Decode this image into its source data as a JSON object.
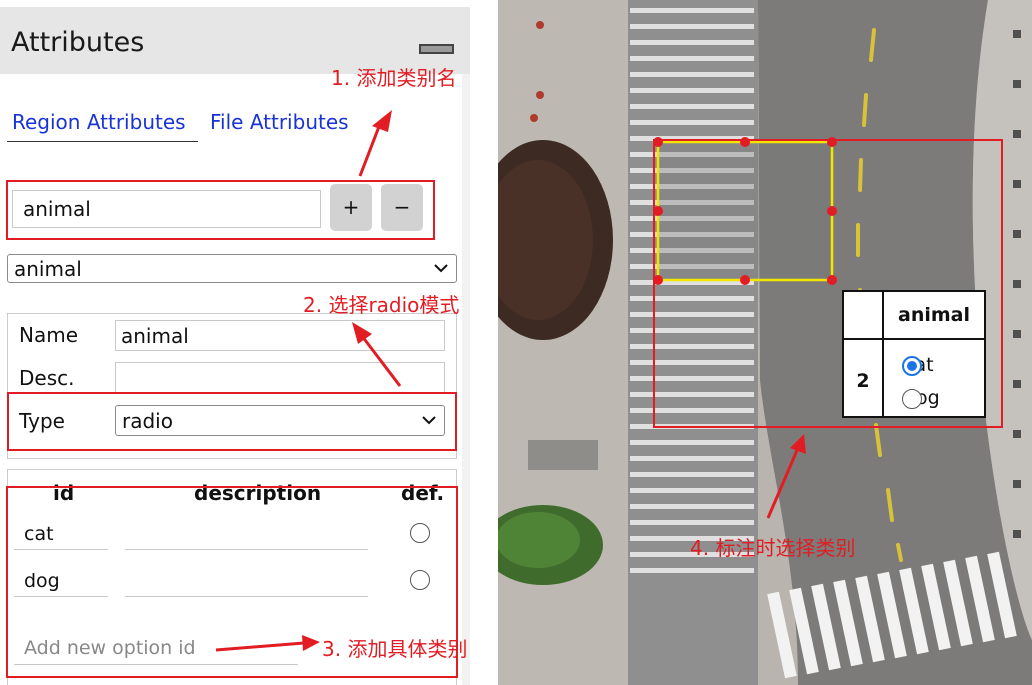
{
  "panel": {
    "title": "Attributes",
    "tabs": [
      "Region Attributes",
      "File Attributes"
    ],
    "attribute_name_value": "animal",
    "add_button": "+",
    "remove_button": "−",
    "attribute_select_value": "animal",
    "fields": {
      "name_label": "Name",
      "name_value": "animal",
      "desc_label": "Desc.",
      "desc_value": "",
      "type_label": "Type",
      "type_value": "radio"
    },
    "options_table": {
      "headers": [
        "id",
        "description",
        "def."
      ],
      "rows": [
        {
          "id": "cat",
          "description": "",
          "default": false
        },
        {
          "id": "dog",
          "description": "",
          "default": false
        }
      ],
      "new_option_placeholder": "Add new option id"
    }
  },
  "annotations": {
    "step1": "1. 添加类别名",
    "step2": "2. 选择radio模式",
    "step3": "3. 添加具体类别",
    "step4": "4. 标注时选择类别"
  },
  "image_popup": {
    "header": "animal",
    "region_id": "2",
    "options": [
      "cat",
      "dog"
    ],
    "selected": "cat"
  },
  "colors": {
    "annotation_red": "#e11d23",
    "tab_link_blue": "#1a33d6",
    "region_outline_yellow": "#f2e600",
    "radio_selected_blue": "#1a73e8"
  }
}
